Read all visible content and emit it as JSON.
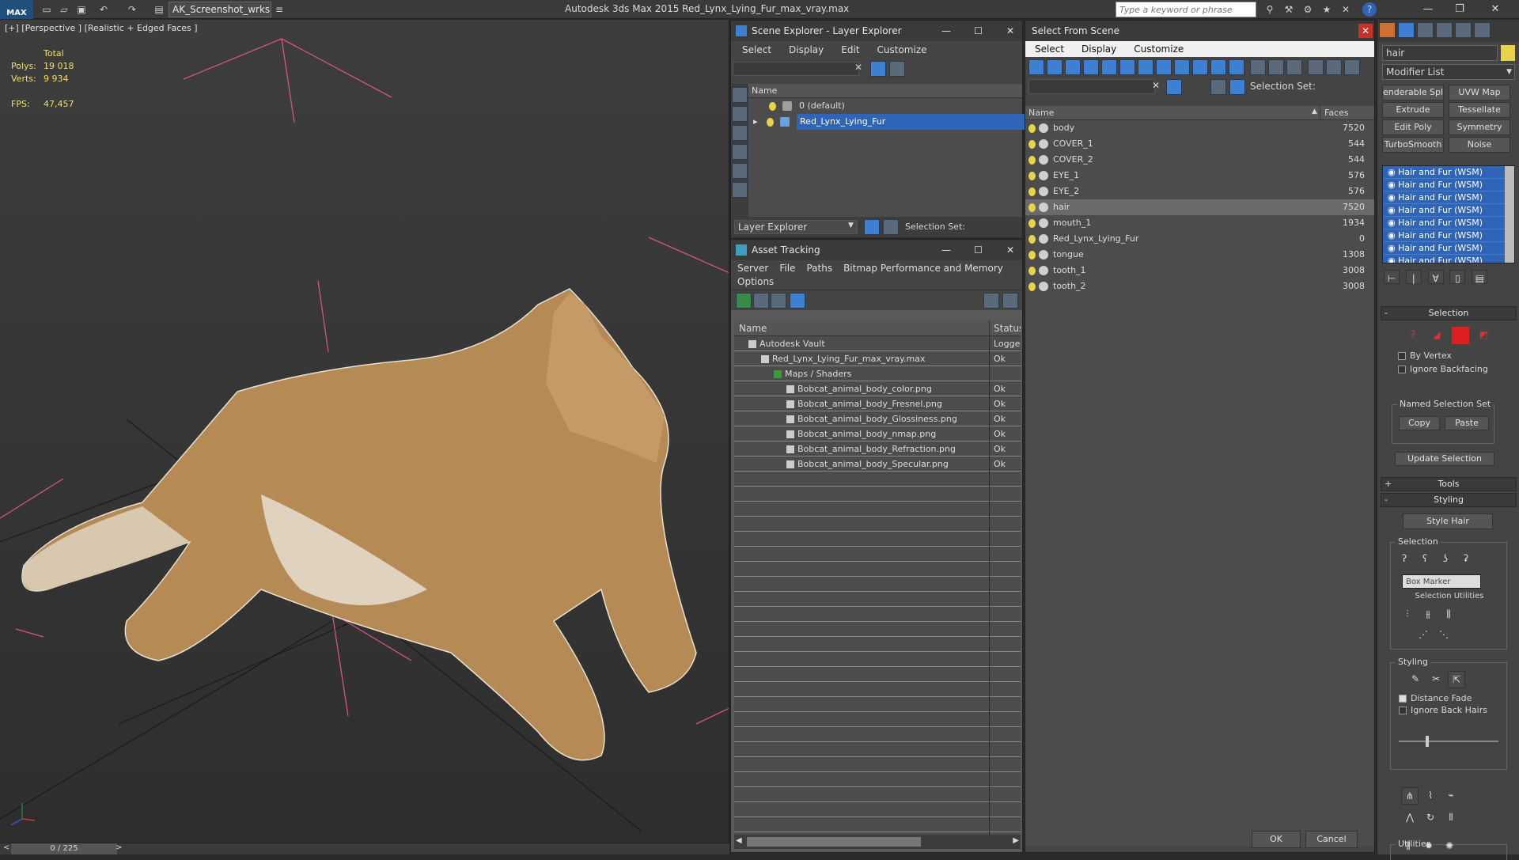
{
  "app": {
    "logo": "MAX",
    "workspace": "AK_Screenshot_wrksp",
    "title": "Autodesk 3ds Max  2015     Red_Lynx_Lying_Fur_max_vray.max",
    "search_placeholder": "Type a keyword or phrase"
  },
  "viewport": {
    "label": "[+] [Perspective ] [Realistic + Edged Faces ]",
    "total_label": "Total",
    "polys_label": "Polys:",
    "polys_value": "19 018",
    "verts_label": "Verts:",
    "verts_value": "9 934",
    "fps_label": "FPS:",
    "fps_value": "47,457"
  },
  "timeline": {
    "frame": "0 / 225"
  },
  "scene_explorer": {
    "title": "Scene Explorer - Layer Explorer",
    "menu": [
      "Select",
      "Display",
      "Edit",
      "Customize"
    ],
    "col_name": "Name",
    "rows": [
      "0 (default)",
      "Red_Lynx_Lying_Fur"
    ],
    "footer_dropdown": "Layer Explorer",
    "footer_selset": "Selection Set:"
  },
  "asset_tracking": {
    "title": "Asset Tracking",
    "menu": [
      "Server",
      "File",
      "Paths",
      "Bitmap Performance and Memory"
    ],
    "menu2": "Options",
    "col_name": "Name",
    "col_status": "Status",
    "rows": [
      {
        "name": "Autodesk Vault",
        "status": "Logged",
        "indent": 0
      },
      {
        "name": "Red_Lynx_Lying_Fur_max_vray.max",
        "status": "Ok",
        "indent": 1
      },
      {
        "name": "Maps / Shaders",
        "status": "",
        "indent": 2
      },
      {
        "name": "Bobcat_animal_body_color.png",
        "status": "Ok",
        "indent": 3
      },
      {
        "name": "Bobcat_animal_body_Fresnel.png",
        "status": "Ok",
        "indent": 3
      },
      {
        "name": "Bobcat_animal_body_Glossiness.png",
        "status": "Ok",
        "indent": 3
      },
      {
        "name": "Bobcat_animal_body_nmap.png",
        "status": "Ok",
        "indent": 3
      },
      {
        "name": "Bobcat_animal_body_Refraction.png",
        "status": "Ok",
        "indent": 3
      },
      {
        "name": "Bobcat_animal_body_Specular.png",
        "status": "Ok",
        "indent": 3
      }
    ]
  },
  "select_from_scene": {
    "title": "Select From Scene",
    "menu": [
      "Select",
      "Display",
      "Customize"
    ],
    "selset": "Selection Set:",
    "col_name": "Name",
    "col_faces": "Faces",
    "rows": [
      {
        "name": "body",
        "faces": "7520"
      },
      {
        "name": "COVER_1",
        "faces": "544"
      },
      {
        "name": "COVER_2",
        "faces": "544"
      },
      {
        "name": "EYE_1",
        "faces": "576"
      },
      {
        "name": "EYE_2",
        "faces": "576"
      },
      {
        "name": "hair",
        "faces": "7520"
      },
      {
        "name": "mouth_1",
        "faces": "1934"
      },
      {
        "name": "Red_Lynx_Lying_Fur",
        "faces": "0"
      },
      {
        "name": "tongue",
        "faces": "1308"
      },
      {
        "name": "tooth_1",
        "faces": "3008"
      },
      {
        "name": "tooth_2",
        "faces": "3008"
      }
    ],
    "ok": "OK",
    "cancel": "Cancel"
  },
  "command_panel": {
    "object_name": "hair",
    "modifier_list": "Modifier List",
    "mod_buttons": [
      "enderable Spli",
      "UVW Map",
      "Extrude",
      "Tessellate",
      "Edit Poly",
      "Symmetry",
      "TurboSmooth",
      "Noise"
    ],
    "stack_item": "Hair and Fur (WSM)",
    "selection_title": "Selection",
    "by_vertex": "By Vertex",
    "ignore_backfacing": "Ignore Backfacing",
    "named_sel_set": "Named Selection Set",
    "copy": "Copy",
    "paste": "Paste",
    "update_selection": "Update Selection",
    "tools_title": "Tools",
    "styling_title": "Styling",
    "style_hair": "Style Hair",
    "sel_group": "Selection",
    "box_marker": "Box Marker",
    "sel_utilities": "Selection Utilities",
    "styling_group": "Styling",
    "distance_fade": "Distance Fade",
    "ignore_back_hairs": "Ignore Back Hairs",
    "utilities_group": "Utilities"
  },
  "colors": {
    "accent": "#2f64b6",
    "bulb": "#e8d24a",
    "highlight": "#3d7fd0"
  }
}
